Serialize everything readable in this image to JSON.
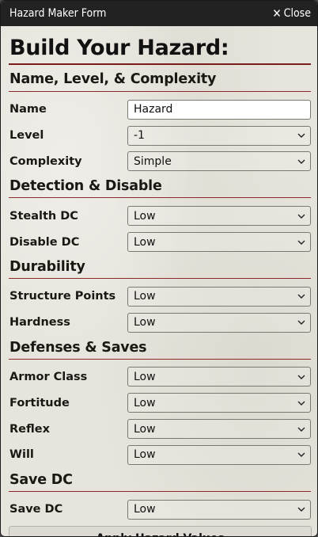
{
  "window": {
    "title": "Hazard Maker Form",
    "close_label": "Close"
  },
  "form": {
    "heading": "Build Your Hazard:",
    "sections": {
      "nlc": "Name, Level, & Complexity",
      "detect": "Detection & Disable",
      "durability": "Durability",
      "defenses": "Defenses & Saves",
      "savedc": "Save DC"
    },
    "fields": {
      "name": {
        "label": "Name",
        "value": "Hazard"
      },
      "level": {
        "label": "Level",
        "value": "-1"
      },
      "complexity": {
        "label": "Complexity",
        "value": "Simple"
      },
      "stealth": {
        "label": "Stealth DC",
        "value": "Low"
      },
      "disable": {
        "label": "Disable DC",
        "value": "Low"
      },
      "structure": {
        "label": "Structure Points",
        "value": "Low"
      },
      "hardness": {
        "label": "Hardness",
        "value": "Low"
      },
      "ac": {
        "label": "Armor Class",
        "value": "Low"
      },
      "fortitude": {
        "label": "Fortitude",
        "value": "Low"
      },
      "reflex": {
        "label": "Reflex",
        "value": "Low"
      },
      "will": {
        "label": "Will",
        "value": "Low"
      },
      "savedc": {
        "label": "Save DC",
        "value": "Low"
      }
    },
    "apply_label": "Apply Hazard Values"
  },
  "colors": {
    "titlebar": "#222222",
    "accent_rule": "#7a1c1c",
    "parchment": "#e6e4dc"
  },
  "icons": {
    "close": "close-icon",
    "dropdown": "chevron-down-icon"
  }
}
